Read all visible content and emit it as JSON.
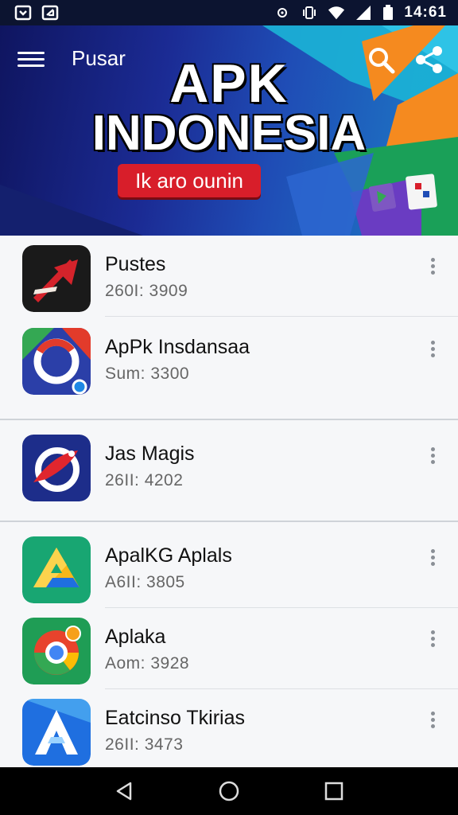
{
  "status_bar": {
    "time": "14:61",
    "left_icons": [
      "notification-icon",
      "download-icon"
    ],
    "right_icons": [
      "location-icon",
      "vibrate-icon",
      "wifi-icon",
      "signal-icon",
      "battery-icon"
    ]
  },
  "header": {
    "section_title": "Pusar",
    "hero_line1": "APK",
    "hero_line2": "INDONESIA",
    "badge_text": "Ik aro ounin",
    "accent_colors": [
      "#f58a1f",
      "#1bb4d6",
      "#d81e2a",
      "#1f2a8c"
    ]
  },
  "apps": [
    {
      "name": "Pustes",
      "meta": "260I: 3909",
      "icon": "arrow-red-app-icon",
      "icon_colors": [
        "#1a1a1a",
        "#d4232b"
      ]
    },
    {
      "name": "ApPk Insdansaa",
      "meta": "Sum: 3300",
      "icon": "ring-blue-app-icon",
      "icon_colors": [
        "#2b3fa8",
        "#e23b2b"
      ]
    },
    {
      "name": "Jas  Magis",
      "meta": "26II: 4202",
      "icon": "magic-bird-app-icon",
      "icon_colors": [
        "#1d2d8a",
        "#e0262e"
      ]
    },
    {
      "name": "ApalKG Aplals",
      "meta": "A6II: 3805",
      "icon": "drive-triangle-app-icon",
      "icon_colors": [
        "#18a672",
        "#f6b71a"
      ]
    },
    {
      "name": "Aplaka",
      "meta": "Aom: 3928",
      "icon": "chrome-circle-app-icon",
      "icon_colors": [
        "#1f9d55",
        "#e8432c"
      ]
    },
    {
      "name": "Eatcinso Tkirias",
      "meta": "26II: 3473",
      "icon": "letter-a-app-icon",
      "icon_colors": [
        "#1f6fe0",
        "#5cc0f6"
      ]
    }
  ],
  "nav_bar": {
    "buttons": [
      "back-icon",
      "home-icon",
      "recents-icon"
    ]
  }
}
